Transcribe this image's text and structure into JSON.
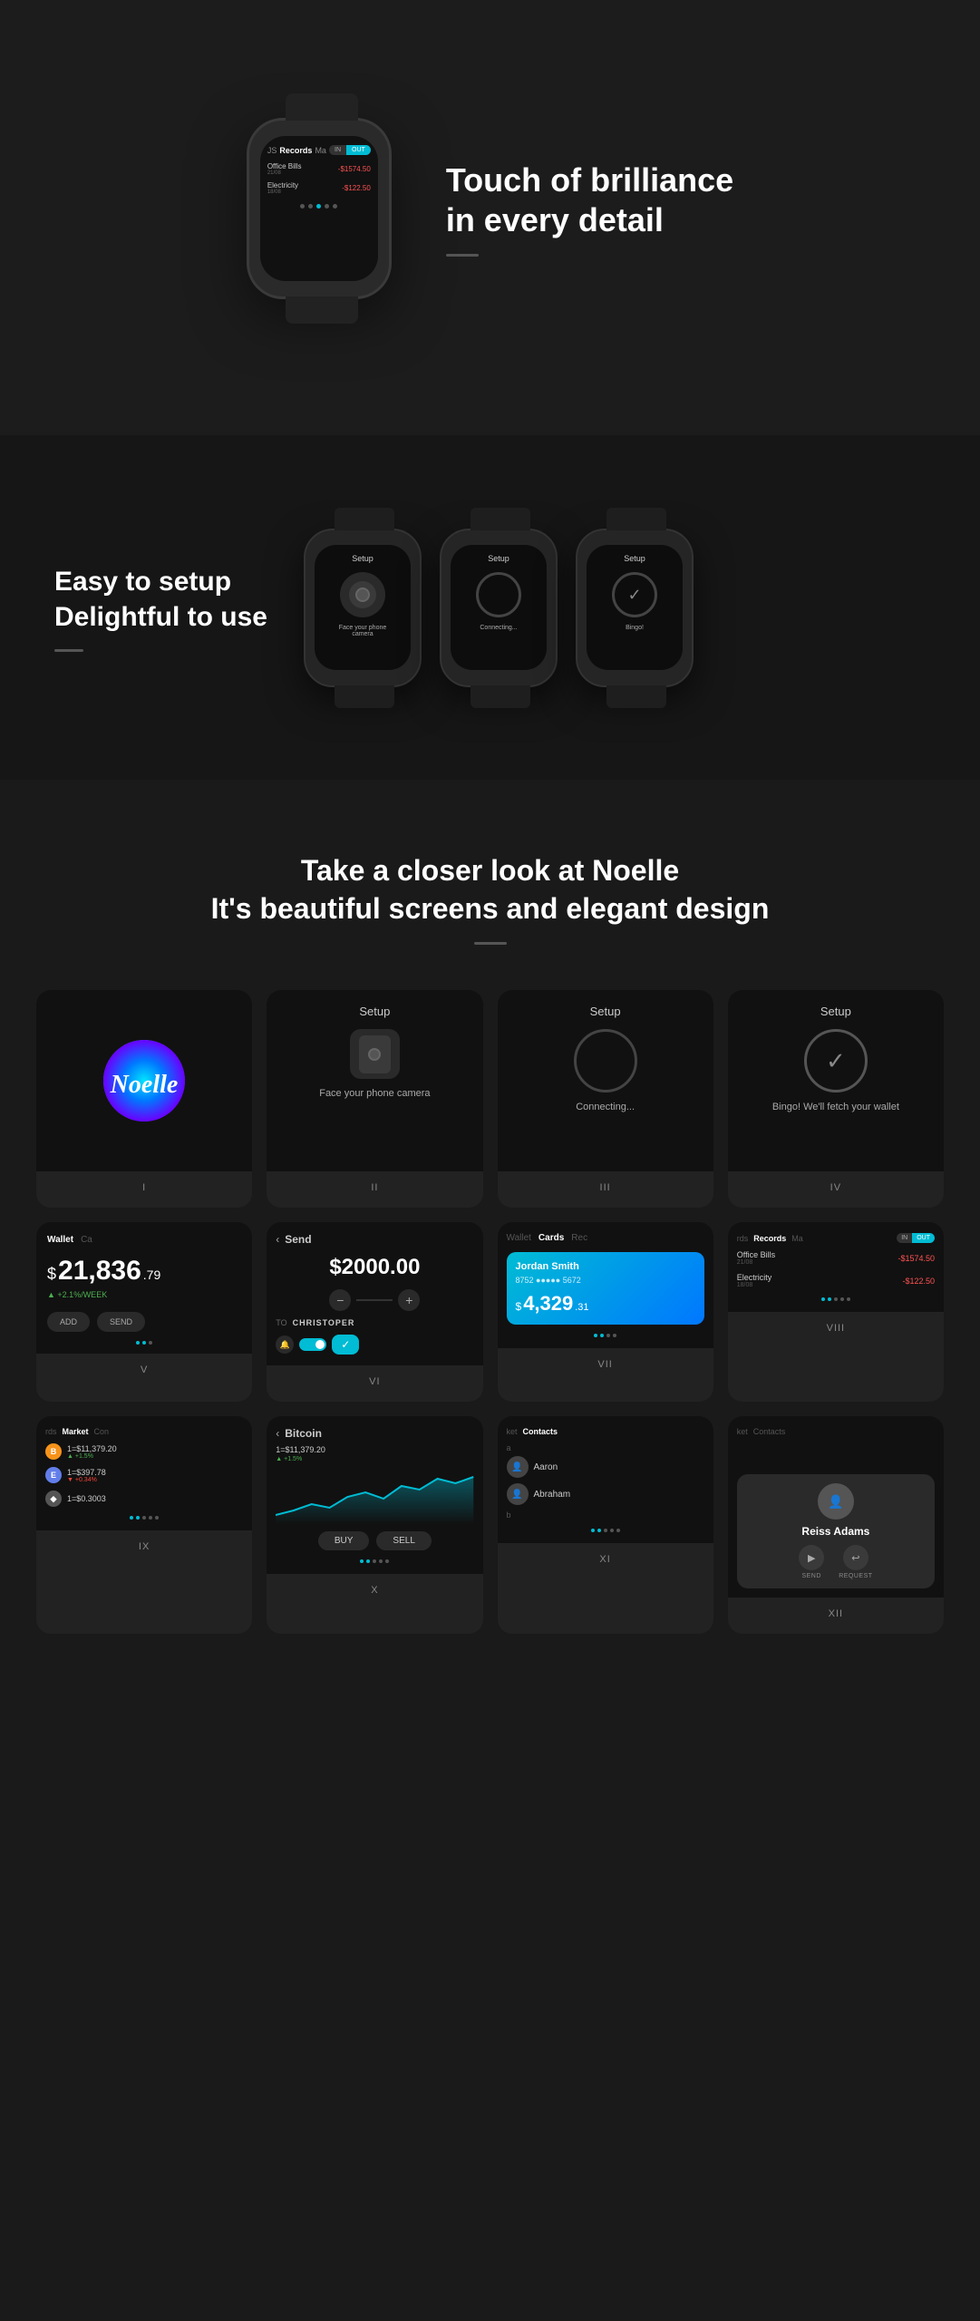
{
  "section_touch": {
    "title_line1": "Touch of brilliance",
    "title_line2": "in every detail",
    "watch_screen": {
      "tab_js": "JS",
      "tab_records": "Records",
      "tab_ma": "Ma",
      "toggle_in": "IN",
      "toggle_out": "OUT",
      "record1_label": "Office Bills",
      "record1_date": "21/08",
      "record1_amount": "-$1574.50",
      "record2_label": "Electricity",
      "record2_date": "18/08",
      "record2_amount": "-$122.50"
    }
  },
  "section_setup": {
    "title_line1": "Easy to setup",
    "title_line2": "Delightful to use",
    "screens": [
      {
        "title": "Setup",
        "desc": "Face your phone camera"
      },
      {
        "title": "Setup",
        "desc": "Connecting..."
      },
      {
        "title": "Setup",
        "desc": "Bingo!"
      }
    ]
  },
  "section_closer": {
    "title_line1": "Take a closer look at Noelle",
    "title_line2": "It's beautiful screens and elegant design",
    "screens": [
      {
        "num": "I",
        "type": "noelle"
      },
      {
        "num": "II",
        "type": "setup-camera",
        "title": "Setup",
        "desc": "Face your phone camera"
      },
      {
        "num": "III",
        "type": "setup-connecting",
        "title": "Setup",
        "desc": "Connecting..."
      },
      {
        "num": "IV",
        "type": "setup-bingo",
        "title": "Setup",
        "desc": "Bingo! We'll fetch your wallet"
      },
      {
        "num": "V",
        "type": "wallet",
        "tab_wallet": "Wallet",
        "tab_ca": "Ca",
        "amount": "21,836",
        "cents": ".79",
        "change": "+2.1%/WEEK",
        "btn_add": "ADD",
        "btn_send": "SEND"
      },
      {
        "num": "VI",
        "type": "send",
        "title": "Send",
        "amount": "$2000.00",
        "to_label": "TO",
        "to_name": "CHRISTOPER"
      },
      {
        "num": "VII",
        "type": "cards",
        "tab_wallet": "Wallet",
        "tab_cards": "Cards",
        "tab_rec": "Rec",
        "card_holder": "Jordan Smith",
        "card_number": "8752 ●●●●● 5672",
        "balance_dollar": "$",
        "balance": "4,329",
        "balance_cents": ".31"
      },
      {
        "num": "VIII",
        "type": "records",
        "tab_rds": "rds",
        "tab_records": "Records",
        "tab_ma": "Ma",
        "toggle_in": "IN",
        "toggle_out": "OUT",
        "record1_label": "Office Bills",
        "record1_date": "21/08",
        "record1_amount": "-$1574.50",
        "record2_label": "Electricity",
        "record2_date": "18/08",
        "record2_amount": "-$122.50"
      },
      {
        "num": "IX",
        "type": "market",
        "tab_rds": "rds",
        "tab_market": "Market",
        "tab_con": "Con",
        "btc_price": "1=$11,379.20",
        "btc_change": "+1.5%",
        "eth_price": "1=$397.78",
        "eth_change": "+0.34%",
        "other_price": "1=$0.3003"
      },
      {
        "num": "X",
        "type": "bitcoin",
        "title": "Bitcoin",
        "price": "1=$11,379.20",
        "change": "+1.5%",
        "btn_buy": "BUY",
        "btn_sell": "SELL"
      },
      {
        "num": "XI",
        "type": "contacts",
        "tab_ket": "ket",
        "tab_contacts": "Contacts",
        "letter": "a",
        "contact1": "Aaron",
        "contact2": "Abraham",
        "letter2": "b"
      },
      {
        "num": "XII",
        "type": "reiss",
        "tab_ket": "ket",
        "tab_contacts": "Contacts",
        "name": "Reiss Adams",
        "btn_send": "SEND",
        "btn_request": "REQUEST"
      }
    ]
  },
  "colors": {
    "accent": "#00bcd4",
    "negative": "#ff5252",
    "positive": "#4caf50"
  }
}
